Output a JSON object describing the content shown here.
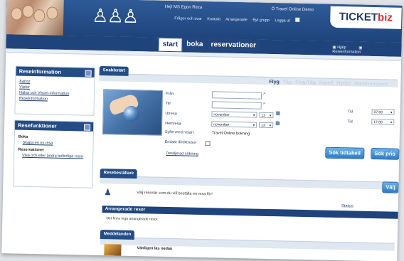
{
  "header": {
    "greeting": "Hej! MS Egon Reza",
    "demo_label": "Ö Travel Online Demo",
    "logo_text": "TICKET",
    "logo_accent": "biz",
    "nav": [
      "Frågor och svar",
      "Kontakt",
      "Arrangerade",
      "Byt grupp",
      "Logga ut"
    ],
    "help": [
      "Hjälp",
      "Reseinformation"
    ]
  },
  "tabs": [
    "start",
    "boka",
    "reservationer"
  ],
  "reseinfo": {
    "title": "Reseinformation",
    "links": [
      "Kartor",
      "Väder",
      "Hälsa och Visum-information",
      "Reseinformation"
    ]
  },
  "resefunk": {
    "title": "Resefunktioner",
    "boka_label": "Boka",
    "boka_link": "Skapa en ny resa",
    "res_label": "Reservationer",
    "res_link": "Visa och eller ändra befintliga resor"
  },
  "snabb": {
    "title": "Snabbstart",
    "modes": [
      "Flyg",
      "Tåg",
      "Flyg/Tåg",
      "Hotell",
      "Hyrbil",
      "Marktransport"
    ],
    "fran": "Från",
    "till": "Till",
    "utresa": "Utresa",
    "hemresa": "Hemresa",
    "syfte_label": "Syfte med resan:",
    "syfte_value": "Travel Online bokning",
    "enkel": "Endast direktresor",
    "detaljerad": "Detaljerad sökning",
    "month_out": "november",
    "day_out": "11",
    "month_home": "november",
    "day_home": "13",
    "tid_label": "Tid",
    "tid_out": "07:00",
    "tid_home": "17:00",
    "btn_tidtabell": "Sök tidtabell",
    "btn_pris": "Sök pris"
  },
  "beställare": {
    "title": "Resebeställare",
    "text": "Välj resenär som du vill beställa en resa för!",
    "btn": "Välj",
    "arr_title": "Arrangerade resor",
    "status": "Status",
    "empty": "Det finns inga arrangerade resor."
  },
  "meddelanden": {
    "title": "Meddelanden",
    "text": "Vänligen läs nedan"
  }
}
